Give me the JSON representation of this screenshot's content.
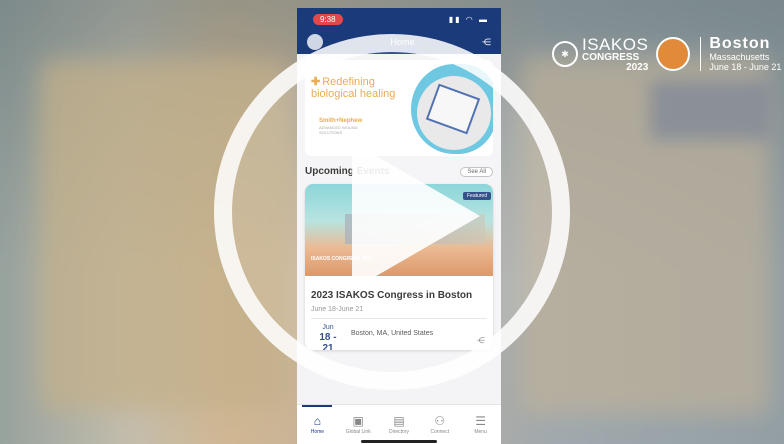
{
  "brand": {
    "isakos": "ISAKOS",
    "congress": "CONGRESS",
    "year": "2023",
    "city": "Boston",
    "state": "Massachusetts",
    "dates": "June 18 - June 21"
  },
  "phone": {
    "time": "9:38",
    "title": "Home",
    "ad": {
      "headline": "Redefining biological healing",
      "sponsor": "Smith+Nephew",
      "sponsor_sub": "ADVANCED WOUND SOLUTIONS"
    },
    "section": {
      "title": "Upcoming Events",
      "see_all": "See All"
    },
    "event": {
      "badge": "Featured",
      "image_logo": "ISAKOS CONGRESS 2023",
      "title": "2023 ISAKOS Congress in Boston",
      "dates": "June 18-June 21",
      "month": "Jun",
      "day_range": "18 - 21",
      "location": "Boston, MA, United States"
    },
    "tabs": [
      {
        "label": "Home",
        "icon": "home-icon"
      },
      {
        "label": "Global Link",
        "icon": "global-link-icon"
      },
      {
        "label": "Directory",
        "icon": "directory-icon"
      },
      {
        "label": "Connect",
        "icon": "connect-icon"
      },
      {
        "label": "Menu",
        "icon": "menu-icon"
      }
    ]
  },
  "colors": {
    "brand_blue": "#1a3a7a",
    "accent_orange": "#e8a238",
    "status_red": "#e2474b"
  }
}
